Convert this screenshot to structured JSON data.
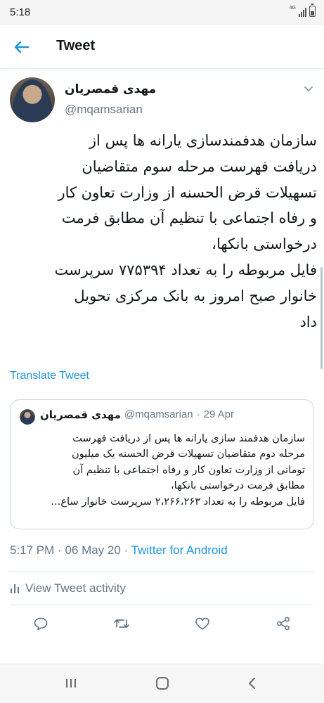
{
  "status_bar": {
    "time": "5:18",
    "network": "4G",
    "battery_level": 0.45
  },
  "header": {
    "title": "Tweet",
    "back_icon": "arrow-left-icon"
  },
  "tweet": {
    "author_name": "مهدی قمصریان",
    "handle": "@mqamsarian",
    "text_lines": [
      "سازمان هدفمندسازی یارانه ها پس از",
      "دریافت فهرست مرحله سوم متقاضیان",
      "تسهیلات قرض الحسنه از وزارت تعاون کار",
      "و رفاه اجتماعی با تنظیم آن مطابق فرمت",
      "درخواستی بانکها،",
      "فایل مربوطه را به تعداد ۷۷۵۳۹۴ سرپرست",
      "خانوار صبح امروز به بانک مرکزی تحویل",
      "داد"
    ],
    "translate_label": "Translate Tweet",
    "time": "5:17 PM",
    "date": "06 May 20",
    "source": "Twitter for Android",
    "activity_label": "View Tweet activity"
  },
  "quoted_tweet": {
    "author_name": "مهدی قمصریان",
    "handle": "@mqamsarian",
    "date": "29 Apr",
    "text_lines": [
      "سازمان هدفمند سازی یارانه ها پس از دریافت فهرست",
      "مرحله دوم متقاضیان تسهیلات قرض الحسنه یک میلیون",
      "تومانی از وزارت تعاون کار و رفاه اجتماعی با تنظیم آن",
      "مطابق فرمت درخواستی بانکها،",
      "فایل مربوطه را به تعداد ۲،۲۶۶،۲۶۳ سرپرست خانوار ساع..."
    ]
  },
  "actions": [
    "reply-icon",
    "retweet-icon",
    "like-icon",
    "share-icon"
  ],
  "colors": {
    "accent": "#1b95e0",
    "secondary_text": "#657786",
    "divider": "#e6ecf0"
  }
}
